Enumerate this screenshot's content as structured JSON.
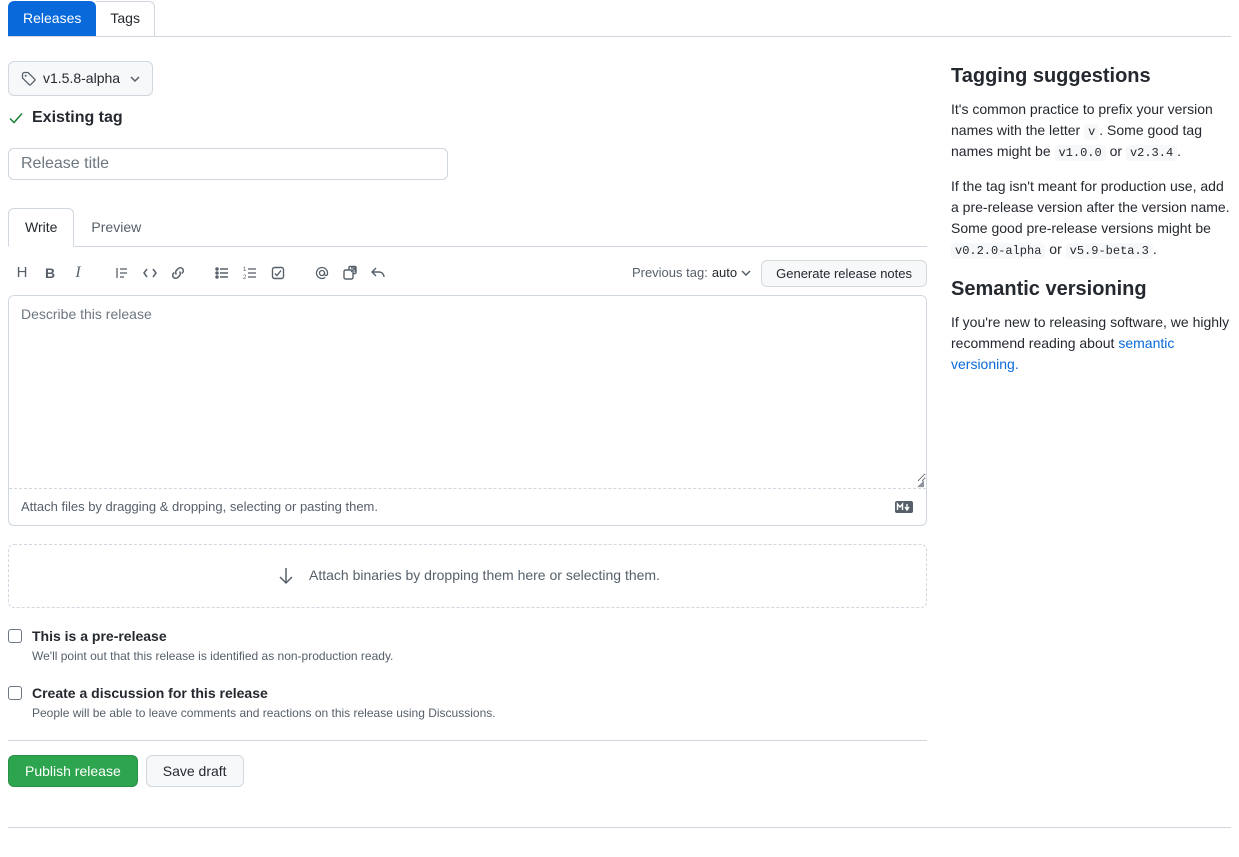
{
  "tabs": {
    "releases": "Releases",
    "tags": "Tags"
  },
  "tagSelector": "v1.5.8-alpha",
  "existingTag": "Existing tag",
  "titlePlaceholder": "Release title",
  "editorTabs": {
    "write": "Write",
    "preview": "Preview"
  },
  "prevTag": {
    "label": "Previous tag:",
    "value": "auto"
  },
  "generateNotes": "Generate release notes",
  "descPlaceholder": "Describe this release",
  "attachFilesHint": "Attach files by dragging & dropping, selecting or pasting them.",
  "binaryDrop": "Attach binaries by dropping them here or selecting them.",
  "prerelease": {
    "label": "This is a pre-release",
    "sub": "We'll point out that this release is identified as non-production ready."
  },
  "discussion": {
    "label": "Create a discussion for this release",
    "sub": "People will be able to leave comments and reactions on this release using Discussions."
  },
  "actions": {
    "publish": "Publish release",
    "draft": "Save draft"
  },
  "sidebar": {
    "taggingTitle": "Tagging suggestions",
    "tagging1a": "It's common practice to prefix your version names with the letter ",
    "tagging1b": ". Some good tag names might be ",
    "tagging1c": " or ",
    "code_v": "v",
    "code_v100": "v1.0.0",
    "code_v234": "v2.3.4",
    "tagging2a": "If the tag isn't meant for production use, add a pre-release version after the version name. Some good pre-release versions might be ",
    "tagging2b": " or ",
    "code_alpha": "v0.2.0-alpha",
    "code_beta": "v5.9-beta.3",
    "semverTitle": "Semantic versioning",
    "semverText": "If you're new to releasing software, we highly recommend reading about ",
    "semverLink": "semantic versioning."
  }
}
